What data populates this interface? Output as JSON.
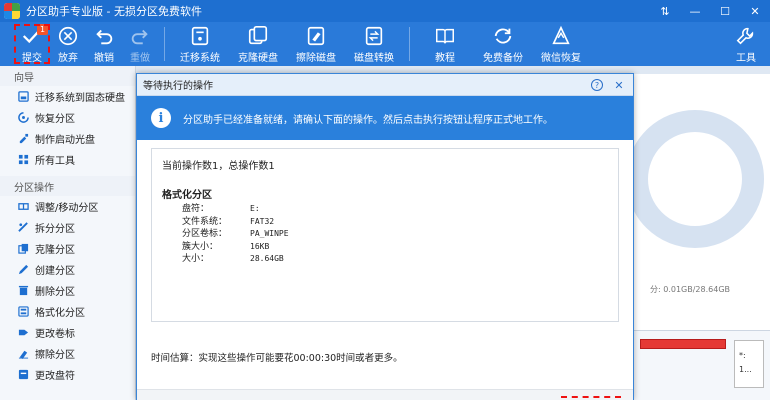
{
  "app": {
    "title": "分区助手专业版 - 无损分区免费软件",
    "window_controls": [
      "⇅",
      "—",
      "☐",
      "✕"
    ]
  },
  "toolbar": {
    "buttons": [
      {
        "label": "提交",
        "icon": "check-icon",
        "disabled": false,
        "badge": "1"
      },
      {
        "label": "放弃",
        "icon": "cancel-icon",
        "disabled": false
      },
      {
        "label": "撤销",
        "icon": "undo-icon",
        "disabled": false
      },
      {
        "label": "重做",
        "icon": "redo-icon",
        "disabled": true
      },
      {
        "label": "迁移系统",
        "icon": "migrate-icon"
      },
      {
        "label": "克隆硬盘",
        "icon": "clone-disk-icon"
      },
      {
        "label": "擦除磁盘",
        "icon": "wipe-disk-icon"
      },
      {
        "label": "磁盘转换",
        "icon": "convert-disk-icon"
      },
      {
        "label": "教程",
        "icon": "tutorial-icon"
      },
      {
        "label": "免费备份",
        "icon": "backup-icon"
      },
      {
        "label": "微信恢复",
        "icon": "wechat-restore-icon"
      },
      {
        "label": "工具",
        "icon": "tools-icon"
      }
    ]
  },
  "sidebar": {
    "sections": [
      {
        "title": "向导",
        "items": [
          "迁移系统到固态硬盘",
          "恢复分区",
          "制作启动光盘",
          "所有工具"
        ]
      },
      {
        "title": "分区操作",
        "items": [
          "调整/移动分区",
          "拆分分区",
          "克隆分区",
          "创建分区",
          "删除分区",
          "格式化分区",
          "更改卷标",
          "擦除分区",
          "更改盘符"
        ]
      }
    ]
  },
  "background": {
    "disk_info": "分: 0.01GB/28.64GB",
    "side_box_lines": [
      "*:",
      "1..."
    ]
  },
  "dialog": {
    "title": "等待执行的操作",
    "help": "?",
    "close": "✕",
    "banner": "分区助手已经准备就绪，请确认下面的操作。然后点击执行按钮让程序正式地工作。",
    "ops_count": "当前操作数1，总操作数1",
    "operation": {
      "name": "格式化分区",
      "fields": [
        {
          "k": "盘符：",
          "v": "E:"
        },
        {
          "k": "文件系统：",
          "v": "FAT32"
        },
        {
          "k": "分区卷标：",
          "v": "PA_WINPE"
        },
        {
          "k": "簇大小：",
          "v": "16KB"
        },
        {
          "k": "大小：",
          "v": "28.64GB"
        }
      ]
    },
    "estimate": "时间估算：实现这些操作可能要花00:00:30时间或者更多。"
  }
}
